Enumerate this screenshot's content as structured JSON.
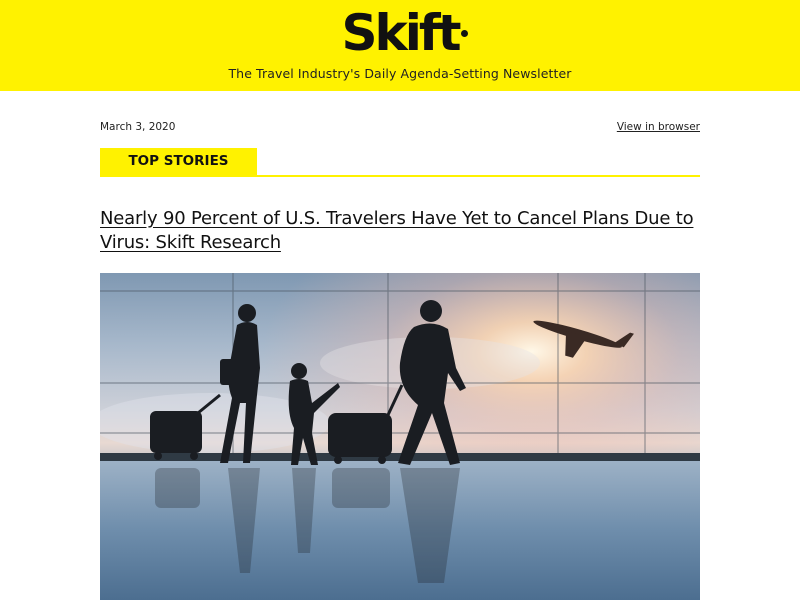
{
  "masthead": {
    "logo_text": "Skift",
    "tagline": "The Travel Industry's Daily Agenda-Setting Newsletter",
    "background_color": "#fff200"
  },
  "meta": {
    "date": "March 3, 2020",
    "view_in_browser": "View in browser"
  },
  "section": {
    "label": "TOP STORIES",
    "accent_color": "#fff200"
  },
  "story": {
    "headline": "Nearly 90 Percent of U.S. Travelers Have Yet to Cancel Plans Due to Virus: Skift Research",
    "image_subject": "silhouette of family with luggage walking in airport terminal with plane taking off"
  }
}
